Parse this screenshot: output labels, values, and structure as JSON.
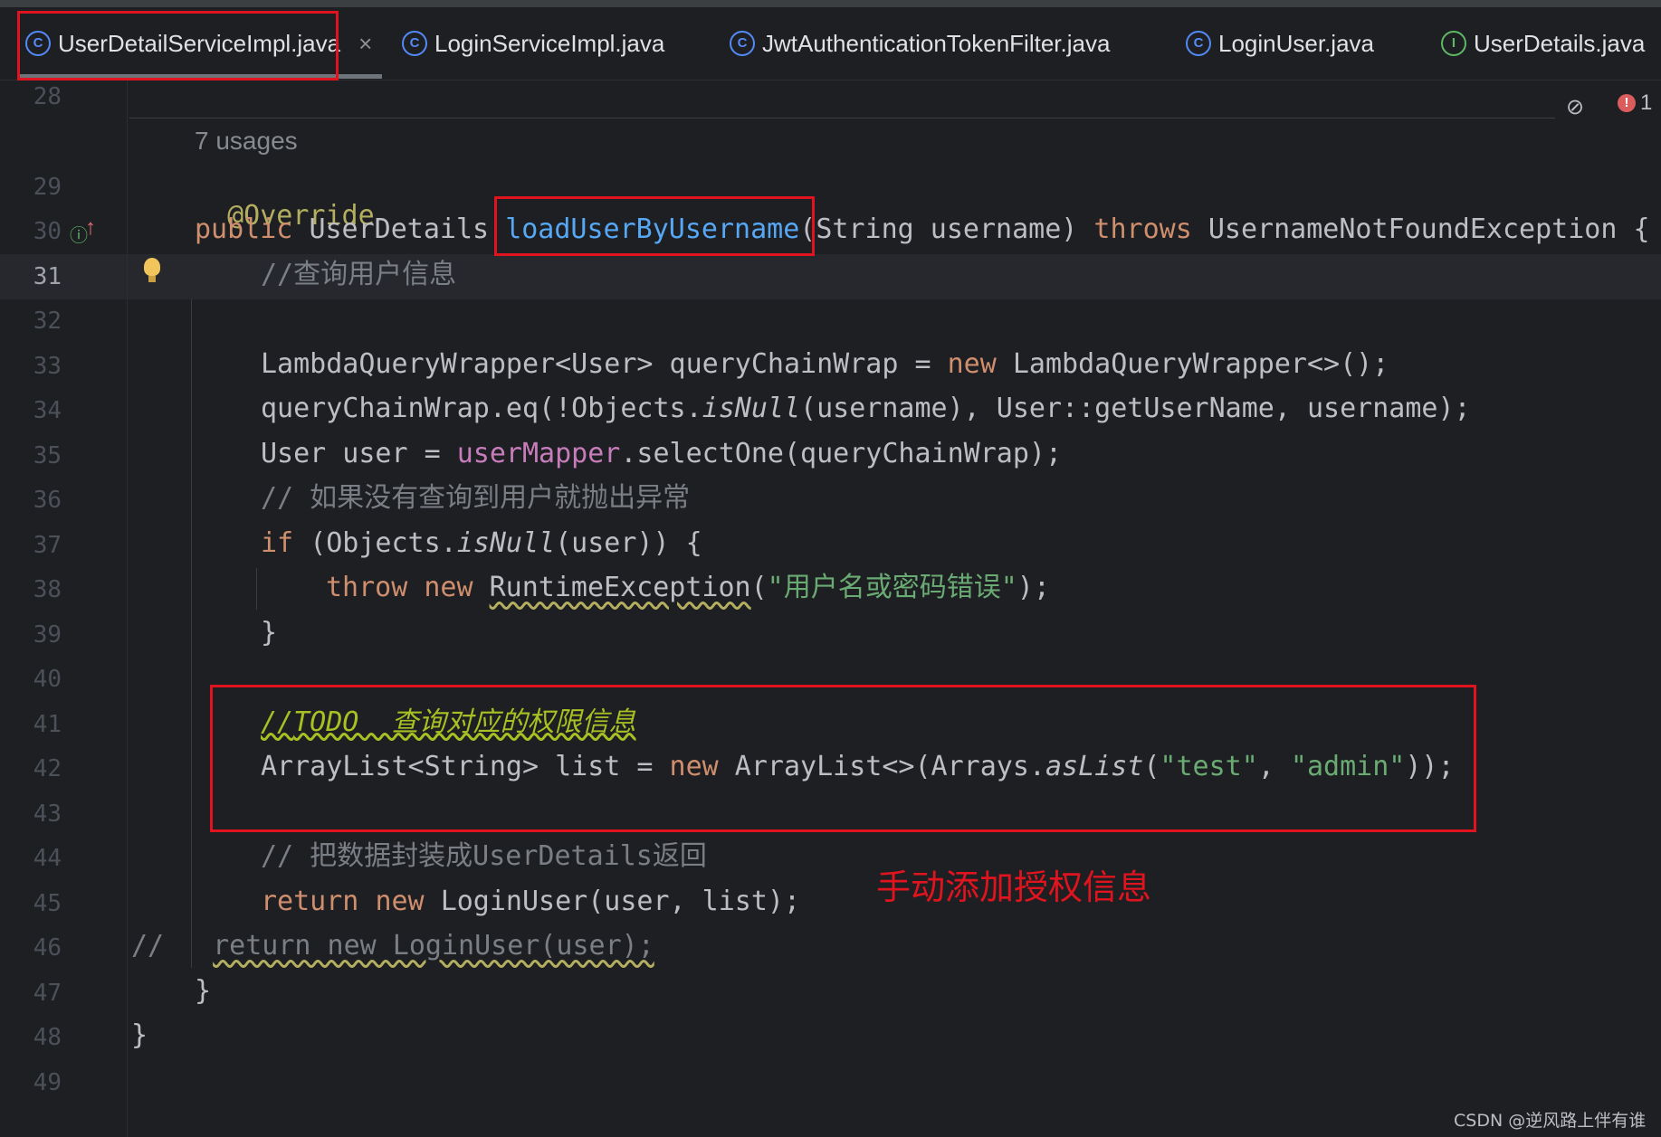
{
  "tabs": [
    {
      "label": "UserDetailServiceImpl.java",
      "icon": "class-icon",
      "active": true,
      "close": "×"
    },
    {
      "label": "LoginServiceImpl.java",
      "icon": "class-icon"
    },
    {
      "label": "JwtAuthenticationTokenFilter.java",
      "icon": "class-icon"
    },
    {
      "label": "LoginUser.java",
      "icon": "class-icon"
    },
    {
      "label": "UserDetails.java",
      "icon": "interface-icon"
    }
  ],
  "icon_glyphs": {
    "class": "C",
    "interface": "I"
  },
  "editor": {
    "usages": "7 usages",
    "error_count": "1",
    "current_line": "31",
    "line_numbers": [
      "28",
      "29",
      "30",
      "31",
      "32",
      "33",
      "34",
      "35",
      "36",
      "37",
      "38",
      "39",
      "40",
      "41",
      "42",
      "43",
      "44",
      "45",
      "46",
      "47",
      "48",
      "49"
    ],
    "code": {
      "l29_ann": "@Override",
      "l30_public": "public ",
      "l30_ret": "UserDetails ",
      "l30_method": "loadUserByUsername",
      "l30_params": "(String username) ",
      "l30_throws": "throws ",
      "l30_exc": "UsernameNotFoundException {",
      "l31_cmt": "//查询用户信息",
      "l33_a": "LambdaQueryWrapper<User> queryChainWrap = ",
      "l33_new": "new ",
      "l33_b": "LambdaQueryWrapper<>();",
      "l34_a": "queryChainWrap.eq(!Objects.",
      "l34_isnull": "isNull",
      "l34_b": "(username), User::getUserName, username);",
      "l35_a": "User user = ",
      "l35_field": "userMapper",
      "l35_b": ".selectOne(queryChainWrap);",
      "l36_cmt": "// 如果没有查询到用户就抛出异常",
      "l37_if": "if ",
      "l37_a": "(Objects.",
      "l37_isnull": "isNull",
      "l37_b": "(user)) {",
      "l38_throw": "throw ",
      "l38_new": "new ",
      "l38_exc": "RuntimeException",
      "l38_open": "(",
      "l38_str": "\"用户名或密码错误\"",
      "l38_close": ");",
      "l39": "}",
      "l41_slash": "//",
      "l41_todo": "TODO  查询对应的权限信息",
      "l42_a": "ArrayList<String> list = ",
      "l42_new": "new ",
      "l42_b": "ArrayList<>(Arrays.",
      "l42_aslist": "asList",
      "l42_c": "(",
      "l42_s1": "\"test\"",
      "l42_comma": ", ",
      "l42_s2": "\"admin\"",
      "l42_d": "));",
      "l44_cmt": "// 把数据封装成UserDetails返回",
      "l45_return": "return ",
      "l45_new": "new ",
      "l45_b": "LoginUser(user, list);",
      "l46_slash": "//",
      "l46_code": "return new LoginUser(user);",
      "l47": "}",
      "l48": "}"
    }
  },
  "annotation_note": "手动添加授权信息",
  "watermark": "CSDN @逆风路上伴有谁",
  "colors": {
    "highlight_box": "#e0141e",
    "background": "#1e1f22",
    "keyword": "#cf8e6d",
    "string": "#6aab73"
  }
}
